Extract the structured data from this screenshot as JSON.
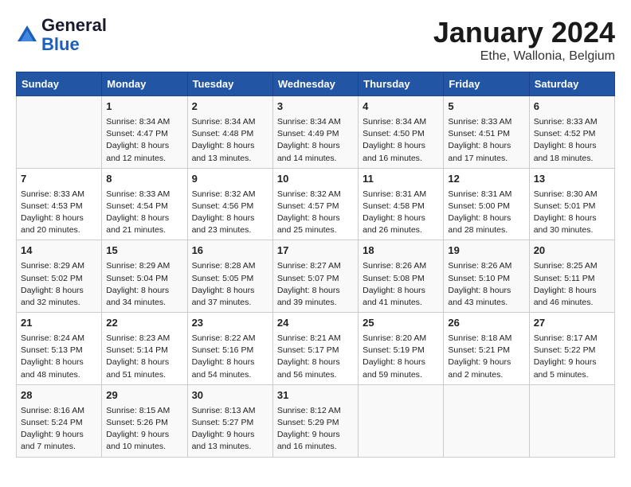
{
  "header": {
    "logo_general": "General",
    "logo_blue": "Blue",
    "title": "January 2024",
    "location": "Ethe, Wallonia, Belgium"
  },
  "days_of_week": [
    "Sunday",
    "Monday",
    "Tuesday",
    "Wednesday",
    "Thursday",
    "Friday",
    "Saturday"
  ],
  "weeks": [
    [
      {
        "day": "",
        "info": ""
      },
      {
        "day": "1",
        "info": "Sunrise: 8:34 AM\nSunset: 4:47 PM\nDaylight: 8 hours\nand 12 minutes."
      },
      {
        "day": "2",
        "info": "Sunrise: 8:34 AM\nSunset: 4:48 PM\nDaylight: 8 hours\nand 13 minutes."
      },
      {
        "day": "3",
        "info": "Sunrise: 8:34 AM\nSunset: 4:49 PM\nDaylight: 8 hours\nand 14 minutes."
      },
      {
        "day": "4",
        "info": "Sunrise: 8:34 AM\nSunset: 4:50 PM\nDaylight: 8 hours\nand 16 minutes."
      },
      {
        "day": "5",
        "info": "Sunrise: 8:33 AM\nSunset: 4:51 PM\nDaylight: 8 hours\nand 17 minutes."
      },
      {
        "day": "6",
        "info": "Sunrise: 8:33 AM\nSunset: 4:52 PM\nDaylight: 8 hours\nand 18 minutes."
      }
    ],
    [
      {
        "day": "7",
        "info": "Sunrise: 8:33 AM\nSunset: 4:53 PM\nDaylight: 8 hours\nand 20 minutes."
      },
      {
        "day": "8",
        "info": "Sunrise: 8:33 AM\nSunset: 4:54 PM\nDaylight: 8 hours\nand 21 minutes."
      },
      {
        "day": "9",
        "info": "Sunrise: 8:32 AM\nSunset: 4:56 PM\nDaylight: 8 hours\nand 23 minutes."
      },
      {
        "day": "10",
        "info": "Sunrise: 8:32 AM\nSunset: 4:57 PM\nDaylight: 8 hours\nand 25 minutes."
      },
      {
        "day": "11",
        "info": "Sunrise: 8:31 AM\nSunset: 4:58 PM\nDaylight: 8 hours\nand 26 minutes."
      },
      {
        "day": "12",
        "info": "Sunrise: 8:31 AM\nSunset: 5:00 PM\nDaylight: 8 hours\nand 28 minutes."
      },
      {
        "day": "13",
        "info": "Sunrise: 8:30 AM\nSunset: 5:01 PM\nDaylight: 8 hours\nand 30 minutes."
      }
    ],
    [
      {
        "day": "14",
        "info": "Sunrise: 8:29 AM\nSunset: 5:02 PM\nDaylight: 8 hours\nand 32 minutes."
      },
      {
        "day": "15",
        "info": "Sunrise: 8:29 AM\nSunset: 5:04 PM\nDaylight: 8 hours\nand 34 minutes."
      },
      {
        "day": "16",
        "info": "Sunrise: 8:28 AM\nSunset: 5:05 PM\nDaylight: 8 hours\nand 37 minutes."
      },
      {
        "day": "17",
        "info": "Sunrise: 8:27 AM\nSunset: 5:07 PM\nDaylight: 8 hours\nand 39 minutes."
      },
      {
        "day": "18",
        "info": "Sunrise: 8:26 AM\nSunset: 5:08 PM\nDaylight: 8 hours\nand 41 minutes."
      },
      {
        "day": "19",
        "info": "Sunrise: 8:26 AM\nSunset: 5:10 PM\nDaylight: 8 hours\nand 43 minutes."
      },
      {
        "day": "20",
        "info": "Sunrise: 8:25 AM\nSunset: 5:11 PM\nDaylight: 8 hours\nand 46 minutes."
      }
    ],
    [
      {
        "day": "21",
        "info": "Sunrise: 8:24 AM\nSunset: 5:13 PM\nDaylight: 8 hours\nand 48 minutes."
      },
      {
        "day": "22",
        "info": "Sunrise: 8:23 AM\nSunset: 5:14 PM\nDaylight: 8 hours\nand 51 minutes."
      },
      {
        "day": "23",
        "info": "Sunrise: 8:22 AM\nSunset: 5:16 PM\nDaylight: 8 hours\nand 54 minutes."
      },
      {
        "day": "24",
        "info": "Sunrise: 8:21 AM\nSunset: 5:17 PM\nDaylight: 8 hours\nand 56 minutes."
      },
      {
        "day": "25",
        "info": "Sunrise: 8:20 AM\nSunset: 5:19 PM\nDaylight: 8 hours\nand 59 minutes."
      },
      {
        "day": "26",
        "info": "Sunrise: 8:18 AM\nSunset: 5:21 PM\nDaylight: 9 hours\nand 2 minutes."
      },
      {
        "day": "27",
        "info": "Sunrise: 8:17 AM\nSunset: 5:22 PM\nDaylight: 9 hours\nand 5 minutes."
      }
    ],
    [
      {
        "day": "28",
        "info": "Sunrise: 8:16 AM\nSunset: 5:24 PM\nDaylight: 9 hours\nand 7 minutes."
      },
      {
        "day": "29",
        "info": "Sunrise: 8:15 AM\nSunset: 5:26 PM\nDaylight: 9 hours\nand 10 minutes."
      },
      {
        "day": "30",
        "info": "Sunrise: 8:13 AM\nSunset: 5:27 PM\nDaylight: 9 hours\nand 13 minutes."
      },
      {
        "day": "31",
        "info": "Sunrise: 8:12 AM\nSunset: 5:29 PM\nDaylight: 9 hours\nand 16 minutes."
      },
      {
        "day": "",
        "info": ""
      },
      {
        "day": "",
        "info": ""
      },
      {
        "day": "",
        "info": ""
      }
    ]
  ]
}
